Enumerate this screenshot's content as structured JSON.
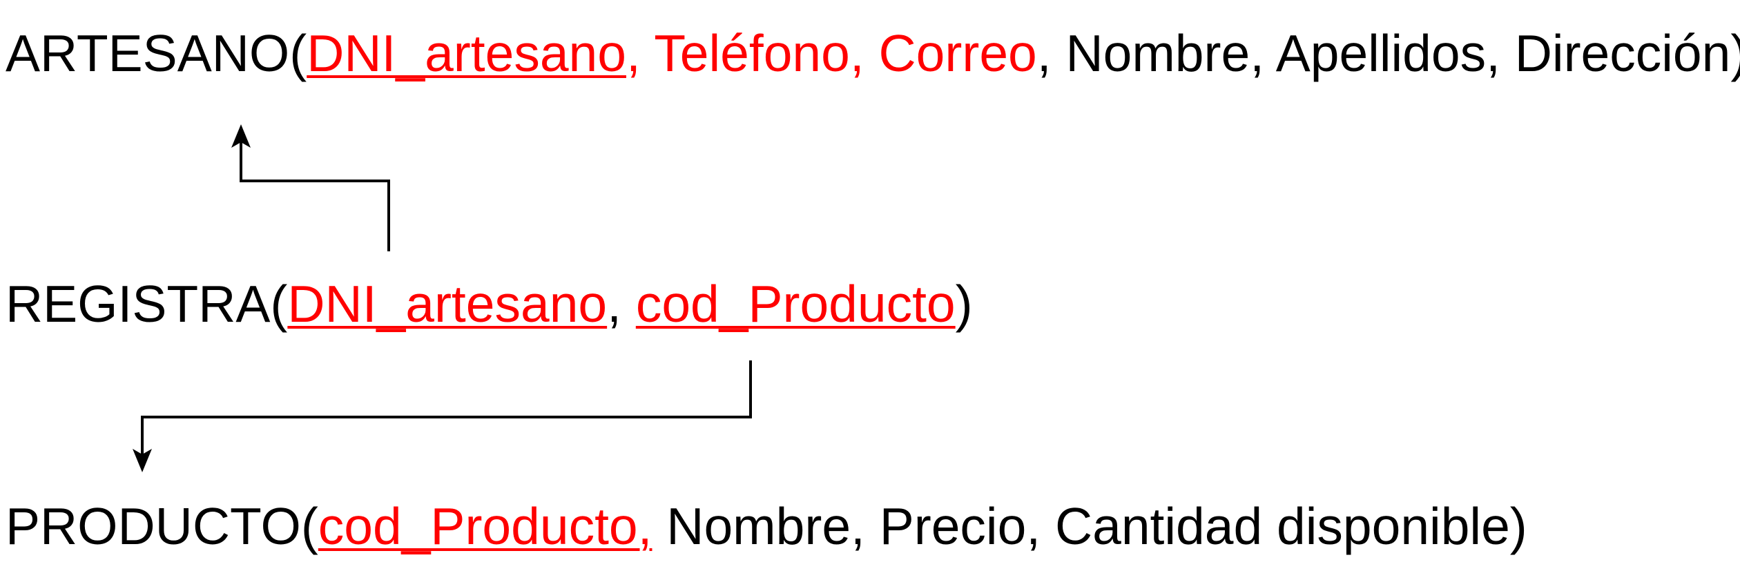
{
  "relations": {
    "artesano": {
      "name": "ARTESANO",
      "open": "(",
      "pk1": "DNI_artesano",
      "pk2_after": ", Teléfono, Correo",
      "rest": ", Nombre, Apellidos, Dirección)"
    },
    "registra": {
      "name": "REGISTRA",
      "open": "(",
      "fk1": "DNI_artesano",
      "sep": ", ",
      "fk2": "cod_Producto",
      "close": ")"
    },
    "producto": {
      "name": "PRODUCTO",
      "open": "(",
      "pk1": "cod_Producto,",
      "rest": " Nombre, Precio, Cantidad disponible)"
    }
  },
  "colors": {
    "key": "#ff0000",
    "text": "#000000",
    "arrow": "#000000"
  },
  "arrows": [
    {
      "from": "REGISTRA.DNI_artesano",
      "to": "ARTESANO.DNI_artesano"
    },
    {
      "from": "REGISTRA.cod_Producto",
      "to": "PRODUCTO.cod_Producto"
    }
  ]
}
